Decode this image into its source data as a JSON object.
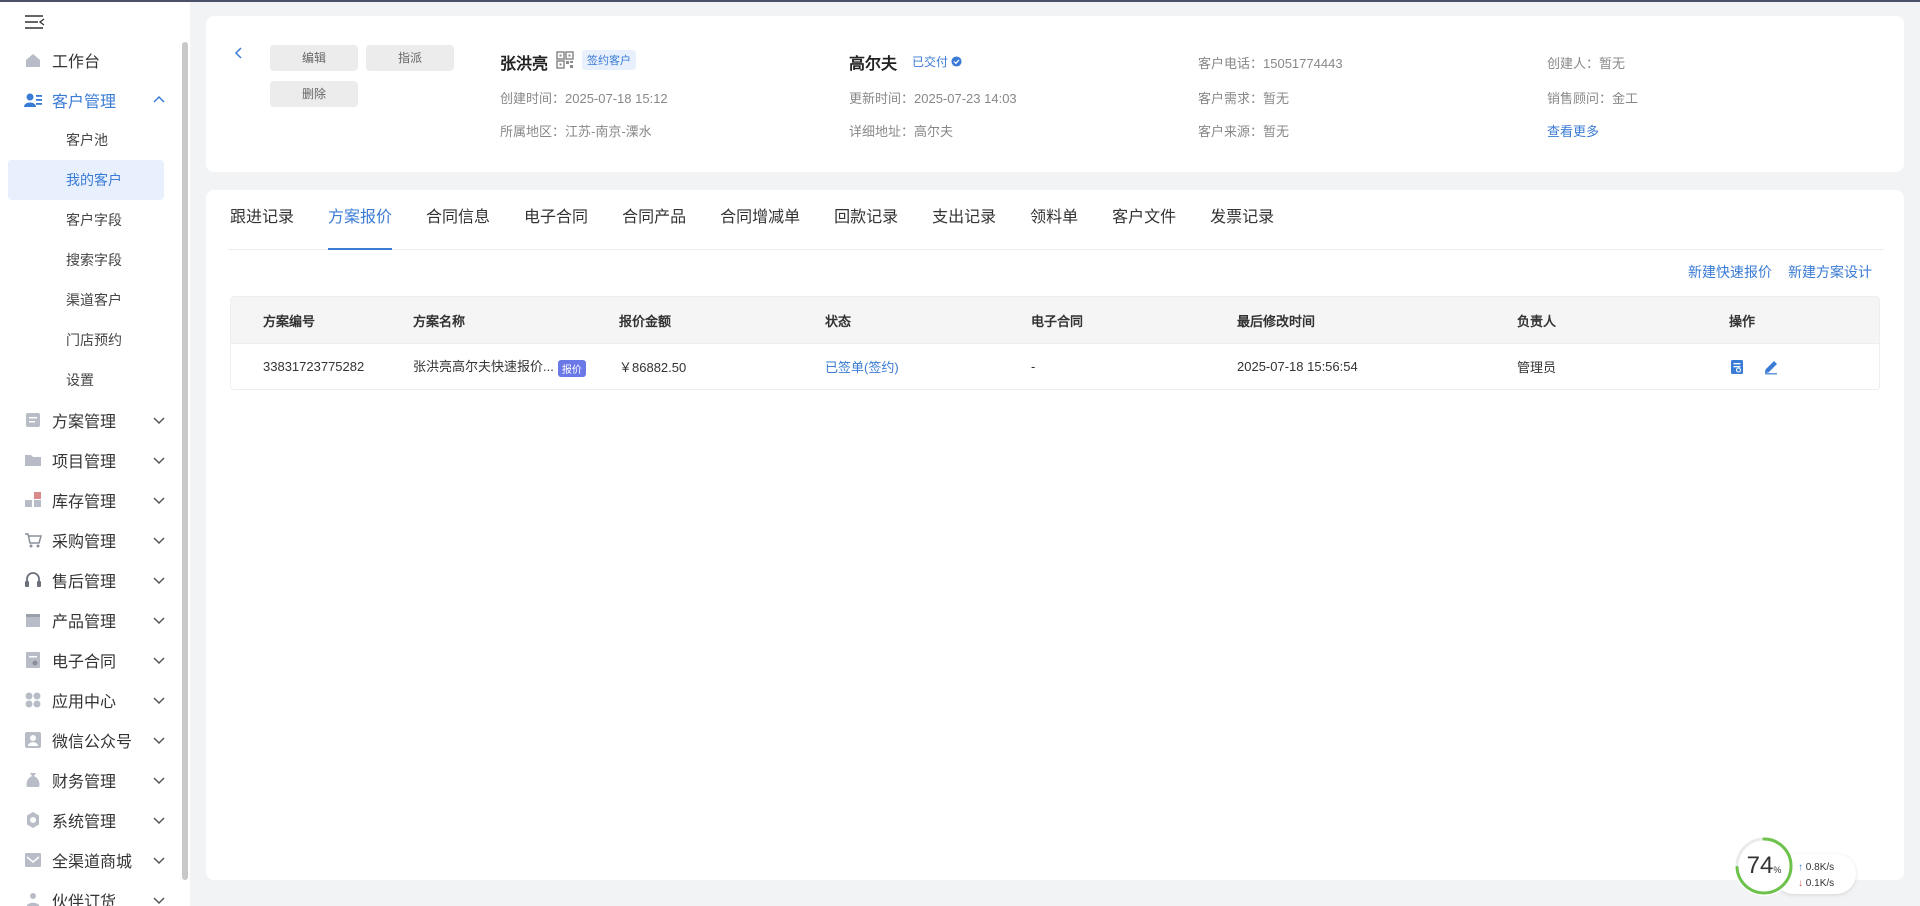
{
  "sidebar": {
    "items": [
      {
        "label": "工作台"
      },
      {
        "label": "客户管理",
        "expanded": true,
        "children": [
          {
            "label": "客户池"
          },
          {
            "label": "我的客户"
          },
          {
            "label": "客户字段"
          },
          {
            "label": "搜索字段"
          },
          {
            "label": "渠道客户"
          },
          {
            "label": "门店预约"
          },
          {
            "label": "设置"
          }
        ]
      },
      {
        "label": "方案管理"
      },
      {
        "label": "项目管理"
      },
      {
        "label": "库存管理"
      },
      {
        "label": "采购管理"
      },
      {
        "label": "售后管理"
      },
      {
        "label": "产品管理"
      },
      {
        "label": "电子合同"
      },
      {
        "label": "应用中心"
      },
      {
        "label": "微信公众号"
      },
      {
        "label": "财务管理"
      },
      {
        "label": "系统管理"
      },
      {
        "label": "全渠道商城"
      },
      {
        "label": "伙伴订货"
      }
    ]
  },
  "customer": {
    "buttons": {
      "edit": "编辑",
      "assign": "指派",
      "delete": "删除"
    },
    "name": "张洪亮",
    "tag": "签约客户",
    "created_label": "创建时间：",
    "created": "2025-07-18 15:12",
    "region_label": "所属地区：",
    "region": "江苏-南京-溧水",
    "project_name": "高尔夫",
    "delivered_status": "已交付",
    "updated_label": "更新时间：",
    "updated": "2025-07-23 14:03",
    "address_label": "详细地址：",
    "address": "高尔夫",
    "phone_label": "客户电话：",
    "phone": "15051774443",
    "demand_label": "客户需求：",
    "demand": "暂无",
    "source_label": "客户来源：",
    "source": "暂无",
    "creator_label": "创建人：",
    "creator": "暂无",
    "sales_label": "销售顾问：",
    "sales": "金工",
    "more": "查看更多"
  },
  "tabs": [
    {
      "label": "跟进记录"
    },
    {
      "label": "方案报价",
      "active": true
    },
    {
      "label": "合同信息"
    },
    {
      "label": "电子合同"
    },
    {
      "label": "合同产品"
    },
    {
      "label": "合同增减单"
    },
    {
      "label": "回款记录"
    },
    {
      "label": "支出记录"
    },
    {
      "label": "领料单"
    },
    {
      "label": "客户文件"
    },
    {
      "label": "发票记录"
    }
  ],
  "actions": {
    "quick_quote": "新建快速报价",
    "plan_design": "新建方案设计"
  },
  "table": {
    "headers": [
      "方案编号",
      "方案名称",
      "报价金额",
      "状态",
      "电子合同",
      "最后修改时间",
      "负责人",
      "操作"
    ],
    "rows": [
      {
        "id": "33831723775282",
        "name": "张洪亮高尔夫快速报价...",
        "badge": "报价",
        "amount": "￥86882.50",
        "status": "已签单(签约)",
        "contract": "-",
        "modified": "2025-07-18 15:56:54",
        "owner": "管理员"
      }
    ]
  },
  "speed_widget": {
    "percent": "74",
    "percent_unit": "%",
    "upload": "0.8",
    "download": "0.1",
    "unit": "K/s"
  },
  "colors": {
    "accent": "#3a7bd5",
    "badge": "#6a78e8"
  }
}
